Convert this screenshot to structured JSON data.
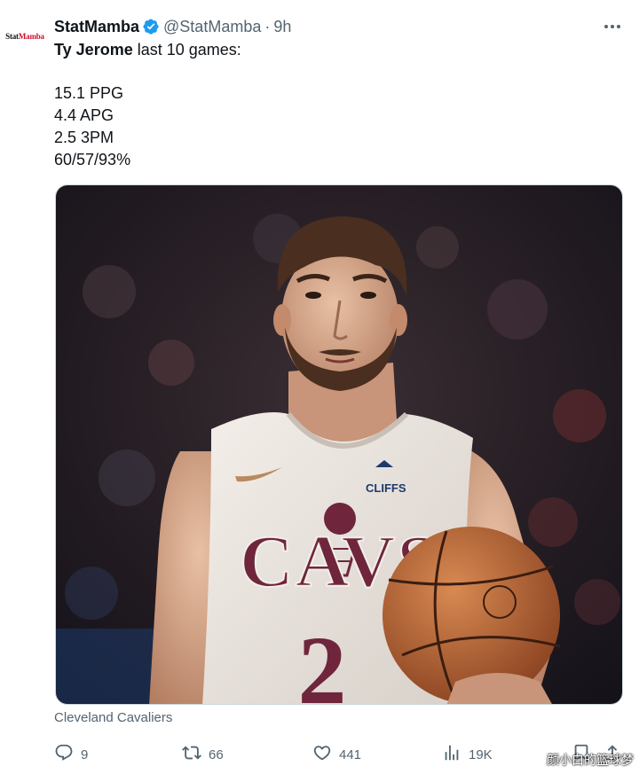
{
  "tweet": {
    "author": {
      "avatar_logo": "StatMamba",
      "display_name": "StatMamba",
      "verified_icon": "verified-badge-icon",
      "handle": "@StatMamba",
      "separator": "·",
      "time": "9h"
    },
    "text": {
      "player_name": "Ty Jerome",
      "intro_rest": " last 10 games:",
      "stats": [
        "15.1 PPG",
        "4.4 APG",
        "2.5 3PM",
        "60/57/93%"
      ]
    },
    "media": {
      "jersey_text": "CAVS",
      "jersey_number": "2",
      "sponsor_patch": "CLIFFS",
      "caption": "Cleveland Cavaliers"
    },
    "actions": {
      "replies": "9",
      "retweets": "66",
      "likes": "441",
      "views": "19K"
    },
    "watermark": "颜小白的篮球梦",
    "colors": {
      "accent_verified": "#1d9bf0",
      "secondary_text": "#536471",
      "cavs_wine": "#6f263d"
    }
  }
}
